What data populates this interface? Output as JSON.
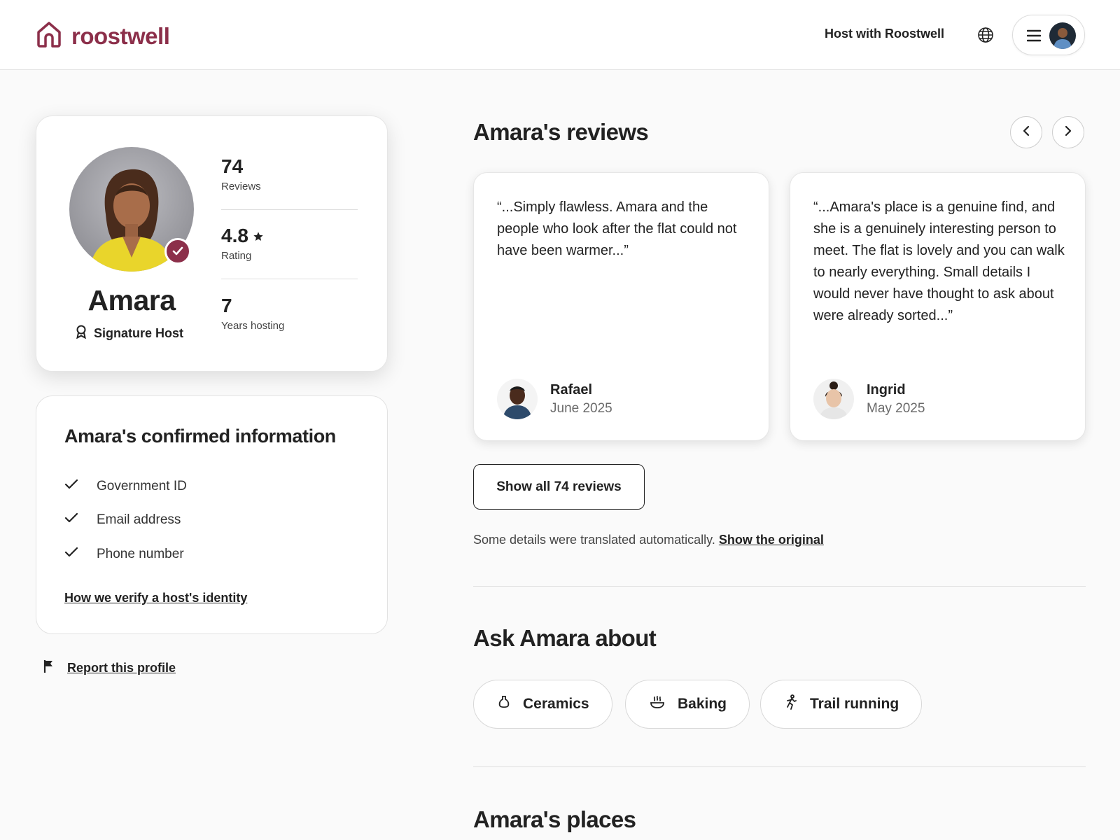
{
  "header": {
    "logo_text": "roostwell",
    "host_link": "Host with Roostwell",
    "globe_icon": "globe-icon",
    "menu_icon": "hamburger-icon"
  },
  "colors": {
    "brand": "#8c2f4a",
    "text": "#222222",
    "muted": "#6a6a6a"
  },
  "profile": {
    "name": "Amara",
    "badge": "Signature Host",
    "stats": [
      {
        "value": "74",
        "label": "Reviews"
      },
      {
        "value": "4.8",
        "label": "Rating"
      },
      {
        "value": "7",
        "label": "Years hosting"
      }
    ]
  },
  "confirmed": {
    "title": "Amara's confirmed information",
    "items": [
      "Government ID",
      "Email address",
      "Phone number"
    ],
    "link": "How we verify a host's identity"
  },
  "report": {
    "label": "Report this profile"
  },
  "reviews": {
    "title": "Amara's reviews",
    "cards": [
      {
        "text": "“...Simply flawless. Amara and the people who look after the flat could not have been warmer...”",
        "name": "Rafael",
        "date": "June 2025"
      },
      {
        "text": "“...Amara's place is a genuine find, and she is a genuinely interesting person to meet. The flat is lovely and you can walk to nearly everything. Small details I would never have thought to ask about were already sorted...”",
        "name": "Ingrid",
        "date": "May 2025"
      }
    ],
    "show_all": "Show all 74 reviews",
    "translate_note": "Some details were translated automatically.",
    "show_original": "Show the original"
  },
  "ask": {
    "title": "Ask Amara about",
    "topics": [
      {
        "label": "Ceramics",
        "icon": "vase-icon"
      },
      {
        "label": "Baking",
        "icon": "bowl-icon"
      },
      {
        "label": "Trail running",
        "icon": "runner-icon"
      }
    ]
  },
  "places": {
    "title": "Amara's places"
  }
}
